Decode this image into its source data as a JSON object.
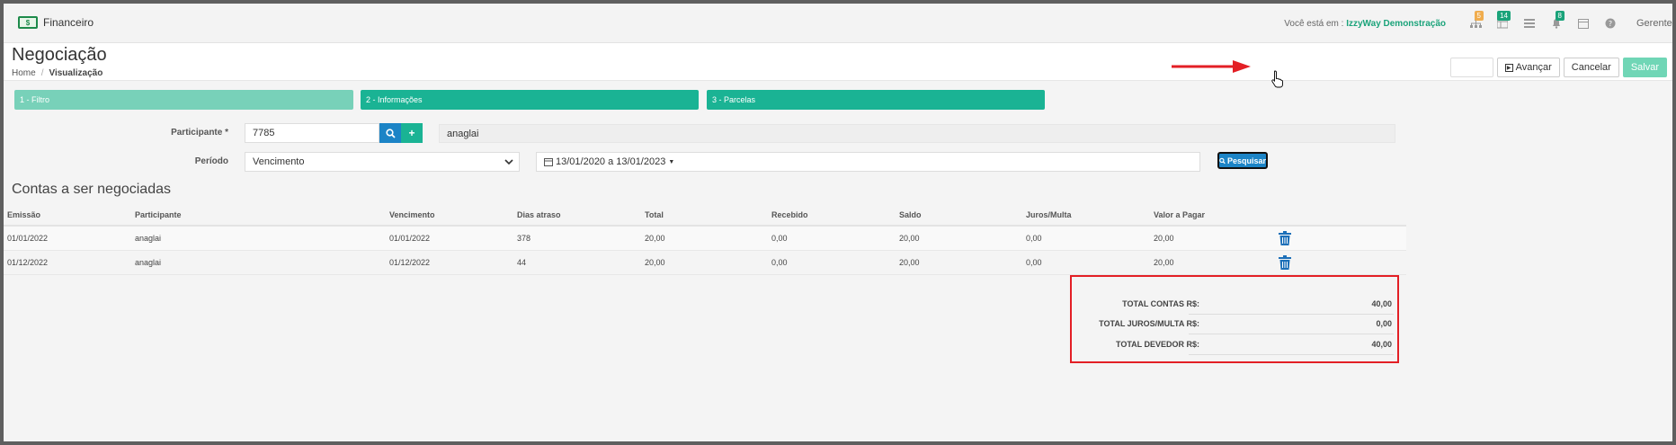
{
  "topbar": {
    "app_name": "Financeiro",
    "context_prefix": "Você está em :",
    "context_company": "IzzyWay Demonstração",
    "badges": {
      "org": "5",
      "tasks": "14",
      "notifications": "8"
    },
    "user": "Gerente"
  },
  "header": {
    "title": "Negociação",
    "breadcrumb": {
      "home": "Home",
      "sep": "/",
      "current": "Visualização"
    },
    "actions": {
      "advance": "Avançar",
      "cancel": "Cancelar",
      "save": "Salvar"
    }
  },
  "steps": [
    "1 - Filtro",
    "2 - Informações",
    "3 - Parcelas"
  ],
  "form": {
    "participant_label": "Participante *",
    "participant_code": "7785",
    "participant_name": "anaglai",
    "period_label": "Período",
    "period_type": "Vencimento",
    "date_range": "13/01/2020 a 13/01/2023",
    "search_button": "Pesquisar"
  },
  "section_title": "Contas a ser negociadas",
  "table": {
    "columns": [
      "Emissão",
      "Participante",
      "Vencimento",
      "Dias atraso",
      "Total",
      "Recebido",
      "Saldo",
      "Juros/Multa",
      "Valor a Pagar"
    ],
    "rows": [
      [
        "01/01/2022",
        "anaglai",
        "01/01/2022",
        "378",
        "20,00",
        "0,00",
        "20,00",
        "0,00",
        "20,00"
      ],
      [
        "01/12/2022",
        "anaglai",
        "01/12/2022",
        "44",
        "20,00",
        "0,00",
        "20,00",
        "0,00",
        "20,00"
      ]
    ]
  },
  "totals": [
    {
      "label": "TOTAL CONTAS R$:",
      "value": "40,00"
    },
    {
      "label": "TOTAL JUROS/MULTA R$:",
      "value": "0,00"
    },
    {
      "label": "TOTAL DEVEDOR R$:",
      "value": "40,00"
    }
  ],
  "colors": {
    "accent_green": "#1ab394",
    "accent_green_light": "#78d1b9",
    "primary_blue": "#1c84c6",
    "annotation_red": "#e31f25"
  }
}
